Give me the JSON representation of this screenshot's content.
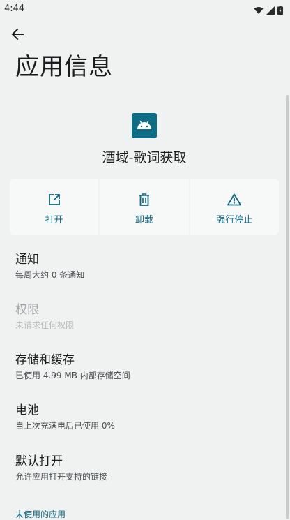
{
  "status_bar": {
    "time": "4:44",
    "icons": [
      "wifi-icon",
      "signal-icon",
      "battery-icon"
    ]
  },
  "header": {
    "back_icon": "arrow-back-icon",
    "title": "应用信息"
  },
  "app": {
    "icon": "android-icon",
    "icon_color": "#0d6c86",
    "name": "酒域-歌词获取"
  },
  "actions": [
    {
      "label": "打开",
      "icon": "open-external-icon"
    },
    {
      "label": "卸载",
      "icon": "trash-icon"
    },
    {
      "label": "强行停止",
      "icon": "warning-icon"
    }
  ],
  "preferences": [
    {
      "title": "通知",
      "summary": "每周大约 0 条通知",
      "enabled": true
    },
    {
      "title": "权限",
      "summary": "未请求任何权限",
      "enabled": false
    },
    {
      "title": "存储和缓存",
      "summary": "已使用 4.99 MB 内部存储空间",
      "enabled": true
    },
    {
      "title": "电池",
      "summary": "自上次充满电后已使用 0%",
      "enabled": true
    },
    {
      "title": "默认打开",
      "summary": "允许应用打开支持的链接",
      "enabled": true
    }
  ],
  "section_header": "未使用的应用",
  "colors": {
    "accent": "#11657e",
    "background": "#f0f2f2"
  }
}
